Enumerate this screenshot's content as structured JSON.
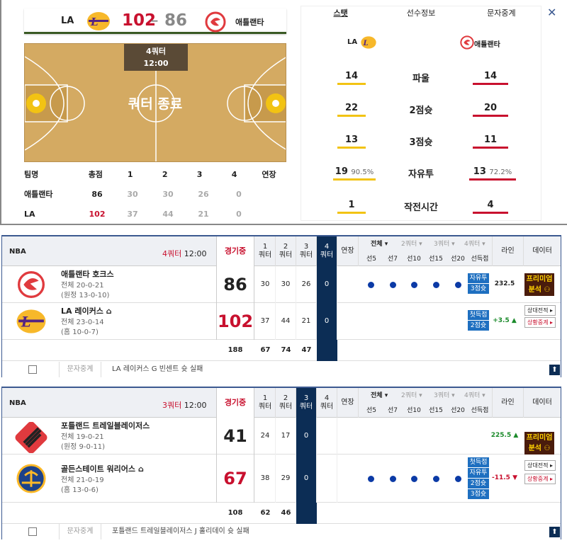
{
  "top": {
    "scorebar": {
      "away": "LA",
      "away_score": "102",
      "home_score": "86",
      "home": "애틀랜타"
    },
    "court": {
      "quarter": "4쿼터",
      "clock": "12:00",
      "status": "쿼터 종료"
    },
    "linescore": {
      "headers": [
        "팀명",
        "총점",
        "1",
        "2",
        "3",
        "4",
        "연장"
      ],
      "rows": [
        {
          "team": "애틀랜타",
          "total": "86",
          "q": [
            "30",
            "30",
            "26",
            "0"
          ]
        },
        {
          "team": "LA",
          "total": "102",
          "q": [
            "37",
            "44",
            "21",
            "0"
          ]
        }
      ]
    },
    "tabs": [
      "스탯",
      "선수정보",
      "문자중계"
    ],
    "close": "✕",
    "stat_header": {
      "left_team": "LA",
      "right_team": "애틀랜타"
    },
    "stats": [
      {
        "label": "파울",
        "left": "14",
        "right": "14"
      },
      {
        "label": "2점슛",
        "left": "22",
        "right": "20"
      },
      {
        "label": "3점슛",
        "left": "13",
        "right": "11"
      },
      {
        "label": "자유투",
        "left": "19",
        "left_pct": "90.5%",
        "right": "13",
        "right_pct": "72.2%"
      },
      {
        "label": "작전시간",
        "left": "1",
        "right": "4"
      }
    ]
  },
  "games": [
    {
      "league": "NBA",
      "quarter": "4쿼터",
      "clock": "12:00",
      "status": "경기중",
      "q_headers": [
        "1\n쿼터",
        "2\n쿼터",
        "3\n쿼터",
        "4\n쿼터"
      ],
      "current_q": 3,
      "ot": "연장",
      "filters": [
        "전체 ▾",
        "2쿼터 ▾",
        "3쿼터 ▾",
        "4쿼터 ▾"
      ],
      "sub": [
        "선5",
        "선7",
        "선10",
        "선15",
        "선20",
        "선득점"
      ],
      "line_h": "라인",
      "data_h": "데이터",
      "teams": [
        {
          "name": "애틀랜타 호크스",
          "rec1": "전체 20-0-21",
          "rec2": "(원정 13-0-10)",
          "score": "86",
          "q": [
            "30",
            "30",
            "26",
            "0"
          ],
          "tags": [
            "자유투",
            "3점슛"
          ],
          "line": "232.5",
          "premium": "프리미엄\n분석 ⚇"
        },
        {
          "name": "LA 레이커스 ⌂",
          "rec1": "전체 23-0-14",
          "rec2": "(홈 10-0-7)",
          "score": "102",
          "q": [
            "37",
            "44",
            "21",
            "0"
          ],
          "tags": [
            "첫득점",
            "2점슛"
          ],
          "line": "+3.5 ▲",
          "btn1": "상대전적 ▸",
          "btn2": "상황중계 ▸"
        }
      ],
      "totals": [
        "188",
        "67",
        "74",
        "47"
      ],
      "foot_btn": "문자중계",
      "foot_text": "LA 레이커스 G 빈센트 슛 실패",
      "up": "⬆"
    },
    {
      "league": "NBA",
      "quarter": "3쿼터",
      "clock": "12:00",
      "status": "경기중",
      "q_headers": [
        "1\n쿼터",
        "2\n쿼터",
        "3\n쿼터",
        "4\n쿼터"
      ],
      "current_q": 2,
      "ot": "연장",
      "filters": [
        "전체 ▾",
        "2쿼터 ▾",
        "3쿼터 ▾",
        "4쿼터 ▾"
      ],
      "sub": [
        "선5",
        "선7",
        "선10",
        "선15",
        "선20",
        "선득점"
      ],
      "line_h": "라인",
      "data_h": "데이터",
      "teams": [
        {
          "name": "포틀랜드 트레일블레이저스",
          "rec1": "전체 19-0-21",
          "rec2": "(원정 9-0-11)",
          "score": "41",
          "q": [
            "24",
            "17",
            "0",
            ""
          ],
          "line": "225.5 ▲",
          "premium": "프리미엄\n분석 ⚇"
        },
        {
          "name": "골든스테이트 워리어스 ⌂",
          "rec1": "전체 21-0-19",
          "rec2": "(홈 13-0-6)",
          "score": "67",
          "q": [
            "38",
            "29",
            "0",
            ""
          ],
          "tags": [
            "첫득점",
            "자유투",
            "2점슛",
            "3점슛"
          ],
          "line": "-11.5 ▼",
          "btn1": "상대전적 ▸",
          "btn2": "상황중계 ▸"
        }
      ],
      "totals": [
        "108",
        "62",
        "46",
        ""
      ],
      "foot_btn": "문자중계",
      "foot_text": "포틀랜드 트레일블레이저스 J 홀리데이 슛 실패",
      "up": "⬆"
    }
  ]
}
